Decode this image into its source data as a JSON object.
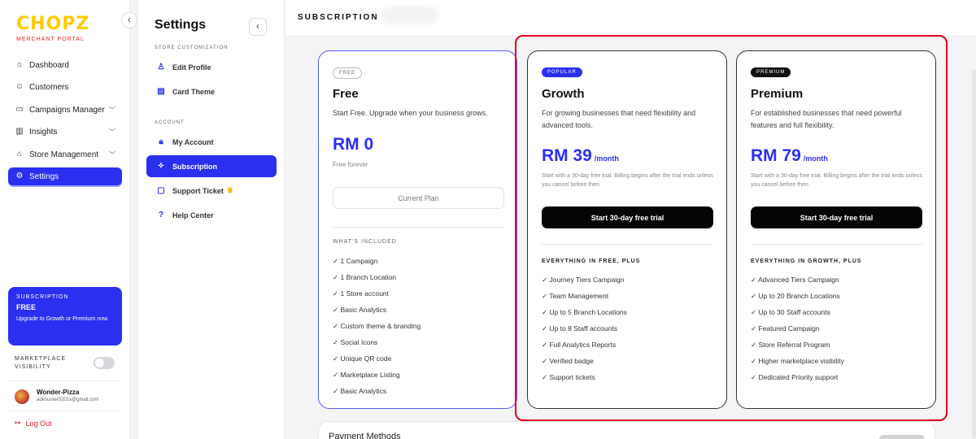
{
  "brand": {
    "logo_text": "CHOPZ",
    "subtitle": "MERCHANT PORTAL",
    "accent": "#2b2ff0",
    "logo_color": "#ffcc00"
  },
  "nav": {
    "collapse_glyph": "‹",
    "items": [
      {
        "label": "Dashboard",
        "icon": "dashboard-icon"
      },
      {
        "label": "Customers",
        "icon": "users-icon"
      },
      {
        "label": "Campaigns Manager",
        "icon": "briefcase-icon"
      },
      {
        "label": "Insights",
        "icon": "bar-chart-icon"
      },
      {
        "label": "Store Management",
        "icon": "store-icon"
      },
      {
        "label": "Settings",
        "icon": "gear-icon",
        "active": true
      }
    ]
  },
  "subscription_card": {
    "label": "SUBSCRIPTION",
    "plan": "FREE",
    "cta": "Upgrade to Growth or Premium now."
  },
  "marketplace": {
    "label_line1": "MARKETPLACE",
    "label_line2": "VISIBILITY",
    "enabled": false
  },
  "user": {
    "name": "Wonder-Pizza",
    "email": "adkhunter0201x@gmail.com"
  },
  "logout_label": "Log Out",
  "settings": {
    "title": "Settings",
    "collapse_glyph": "‹",
    "section_store": "STORE CUSTOMIZATION",
    "section_account": "ACCOUNT",
    "items": [
      {
        "label": "Edit Profile",
        "icon": "user-icon"
      },
      {
        "label": "Card Theme",
        "icon": "card-icon"
      },
      {
        "label": "My Account",
        "icon": "lock-icon"
      },
      {
        "label": "Subscription",
        "icon": "sparkle-icon",
        "active": true
      },
      {
        "label": "Support Ticket",
        "icon": "chat-icon"
      },
      {
        "label": "Help Center",
        "icon": "help-icon"
      }
    ]
  },
  "page": {
    "title": "SUBSCRIPTION"
  },
  "plans": {
    "free": {
      "badge": "FREE",
      "name": "Free",
      "desc": "Start Free. Upgrade when your business grows.",
      "price": "RM 0",
      "price_note": "Free forever",
      "button": "Current Plan",
      "included_head": "WHAT'S INCLUDED",
      "features": [
        "✓ 1 Campaign",
        "✓ 1 Branch Location",
        "✓ 1 Store account",
        "✓ Basic Analytics",
        "✓ Custom theme & branding",
        "✓ Social Icons",
        "✓ Unique QR code",
        "✓ Marketplace Listing",
        "✓ Basic Analytics"
      ]
    },
    "growth": {
      "badge": "POPULAR",
      "name": "Growth",
      "desc": "For growing businesses that need flexibility and advanced tools.",
      "price": "RM 39",
      "per": "/month",
      "trial_note": "Start with a 30-day free trial. Billing begins after the trial ends unless you cancel before then.",
      "button": "Start 30-day free trial",
      "included_head": "EVERYTHING IN FREE, PLUS",
      "features": [
        "✓ Journey Tiers Campaign",
        "✓ Team Management",
        "✓ Up to 5 Branch Locations",
        "✓ Up to 8 Staff accounts",
        "✓ Full Analytics Reports",
        "✓ Verified badge",
        "✓ Support tickets"
      ]
    },
    "premium": {
      "badge": "PREMIUM",
      "name": "Premium",
      "desc": "For established businesses that need powerful features and full flexibility.",
      "price": "RM 79",
      "per": "/month",
      "trial_note": "Start with a 30-day free trial. Billing begins after the trial ends unless you cancel before then.",
      "button": "Start 30-day free trial",
      "included_head": "EVERYTHING IN GROWTH, PLUS",
      "features": [
        "✓ Advanced Tiers Campaign",
        "✓ Up to 20 Branch Locations",
        "✓ Up to 30 Staff accounts",
        "✓ Featured Campaign",
        "✓ Store Referral Program",
        "✓ Higher marketplace visibility",
        "✓ Dedicated Priority support"
      ]
    }
  },
  "payment": {
    "title": "Payment Methods"
  }
}
